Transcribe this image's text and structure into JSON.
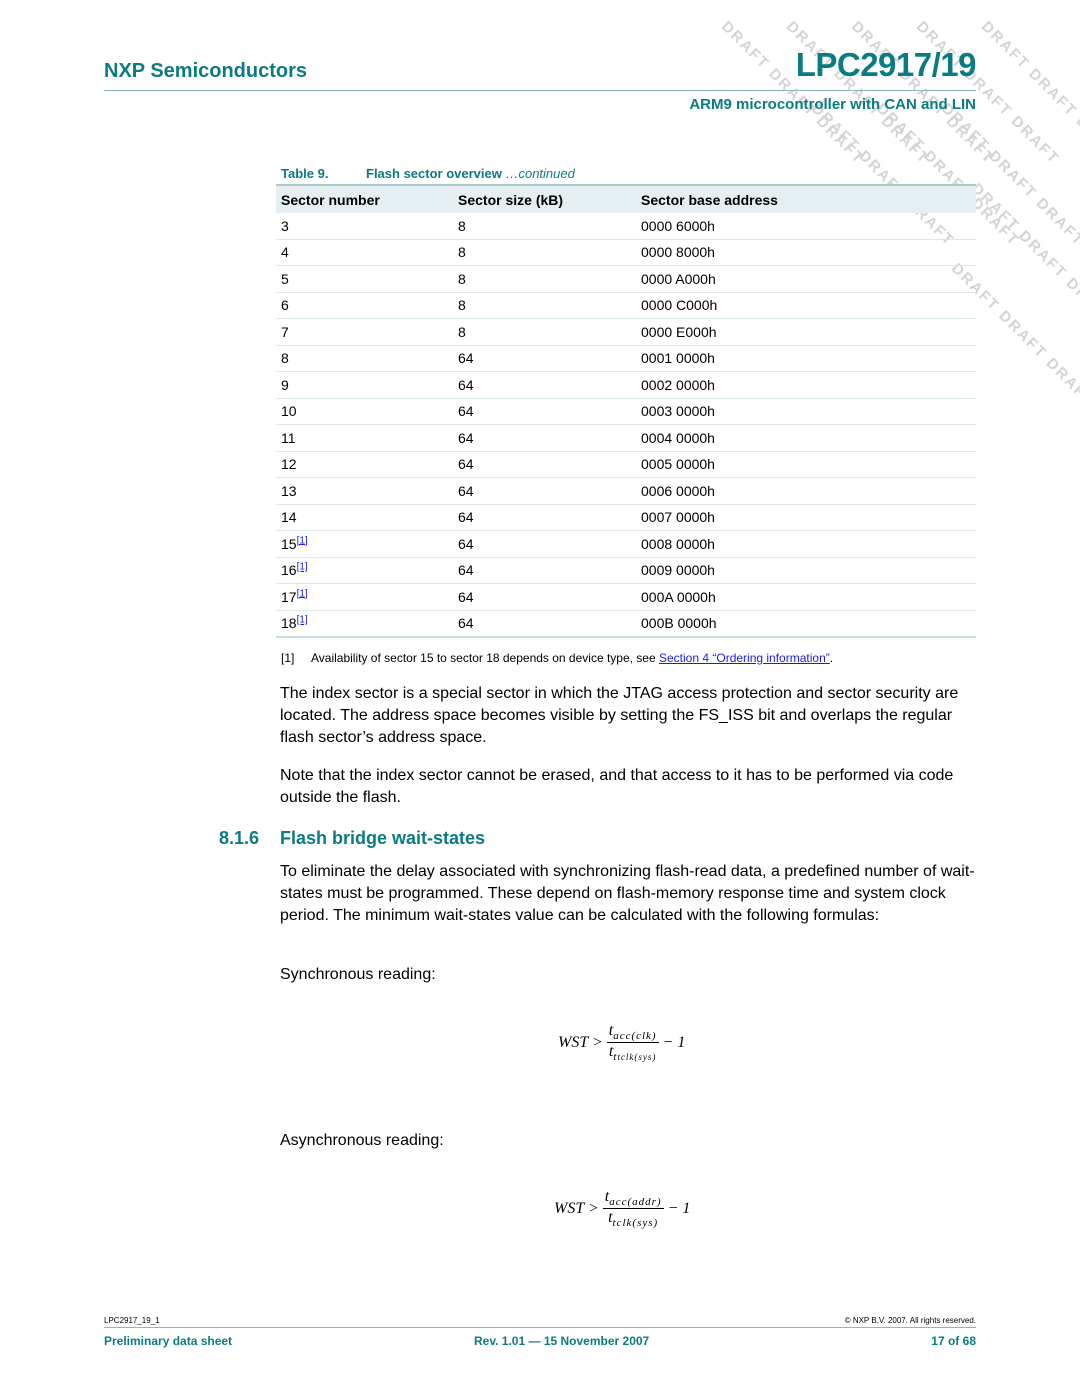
{
  "header": {
    "company": "NXP Semiconductors",
    "title": "LPC2917/19",
    "subtitle": "ARM9 microcontroller with CAN and LIN",
    "watermark": "DRAFT"
  },
  "table": {
    "label": "Table 9.",
    "title": "Flash sector overview",
    "continued": "…continued",
    "columns": [
      "Sector number",
      "Sector size (kB)",
      "Sector base address"
    ],
    "rows": [
      {
        "sector": "3",
        "ref": "",
        "size": "8",
        "address": "0000 6000h"
      },
      {
        "sector": "4",
        "ref": "",
        "size": "8",
        "address": "0000 8000h"
      },
      {
        "sector": "5",
        "ref": "",
        "size": "8",
        "address": "0000 A000h"
      },
      {
        "sector": "6",
        "ref": "",
        "size": "8",
        "address": "0000 C000h"
      },
      {
        "sector": "7",
        "ref": "",
        "size": "8",
        "address": "0000 E000h"
      },
      {
        "sector": "8",
        "ref": "",
        "size": "64",
        "address": "0001 0000h"
      },
      {
        "sector": "9",
        "ref": "",
        "size": "64",
        "address": "0002 0000h"
      },
      {
        "sector": "10",
        "ref": "",
        "size": "64",
        "address": "0003 0000h"
      },
      {
        "sector": "11",
        "ref": "",
        "size": "64",
        "address": "0004 0000h"
      },
      {
        "sector": "12",
        "ref": "",
        "size": "64",
        "address": "0005 0000h"
      },
      {
        "sector": "13",
        "ref": "",
        "size": "64",
        "address": "0006 0000h"
      },
      {
        "sector": "14",
        "ref": "",
        "size": "64",
        "address": "0007 0000h"
      },
      {
        "sector": "15",
        "ref": "[1]",
        "size": "64",
        "address": "0008 0000h"
      },
      {
        "sector": "16",
        "ref": "[1]",
        "size": "64",
        "address": "0009 0000h"
      },
      {
        "sector": "17",
        "ref": "[1]",
        "size": "64",
        "address": "000A 0000h"
      },
      {
        "sector": "18",
        "ref": "[1]",
        "size": "64",
        "address": "000B 0000h"
      }
    ]
  },
  "footnote": {
    "mark": "[1]",
    "text": "Availability of sector 15 to sector 18 depends on device type, see ",
    "link": "Section 4 “Ordering information”",
    "end": "."
  },
  "body": {
    "para1": "The index sector is a special sector in which the JTAG access protection and sector security are located. The address space becomes visible by setting the FS_ISS bit and overlaps the regular flash sector’s address space.",
    "para2": "Note that the index sector cannot be erased, and that access to it has to be performed via code outside the flash.",
    "section_number": "8.1.6",
    "section_title": "Flash bridge wait-states",
    "para3": "To eliminate the delay associated with synchronizing flash-read data, a predefined number of wait-states must be programmed. These depend on flash-memory response time and system clock period. The minimum wait-states value can be calculated with the following formulas:",
    "sync_label": "Synchronous reading:",
    "async_label": "Asynchronous reading:"
  },
  "formulas": {
    "sync": {
      "lhs": "WST >",
      "num_t": "t",
      "num_sub": "acc(clk)",
      "den_t": "t",
      "den_sub_t": "t",
      "den_sub": "tclk(sys)",
      "rhs": "− 1"
    },
    "async": {
      "lhs": "WST >",
      "num_t": "t",
      "num_sub": "acc(addr)",
      "den_t": "t",
      "den_sub": "tclk(sys)",
      "rhs": "− 1"
    }
  },
  "footer": {
    "doc_id": "LPC2917_19_1",
    "copyright": "© NXP B.V. 2007. All rights reserved.",
    "doc_type": "Preliminary data sheet",
    "revision": "Rev. 1.01 — 15 November 2007",
    "page": "17 of 68"
  }
}
